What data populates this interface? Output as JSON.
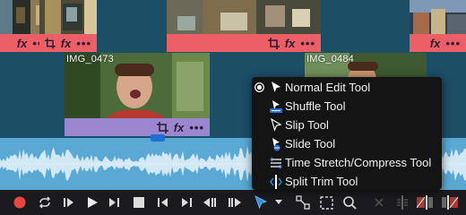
{
  "clips": {
    "top_left": {
      "name": ""
    },
    "top_mid": {
      "name": ""
    },
    "top_right": {
      "name": ""
    },
    "mid_left": {
      "name": "IMG_0473"
    },
    "mid_right": {
      "name": "IMG_0484"
    }
  },
  "clip_bar": {
    "fx_label": "fx",
    "more_label": "•••"
  },
  "colors": {
    "background": "#1c4e66",
    "clip_bar_red": "#ec5f67",
    "clip_bar_purple": "#9a87cf",
    "waveform": "#5aa9d5",
    "accent_blue": "#2e8ff0",
    "record_red": "#e8473f",
    "menu_bg": "#141414"
  },
  "menu": {
    "items": [
      {
        "label": "Normal Edit Tool",
        "icon": "pointer-arrow-icon",
        "selected": true
      },
      {
        "label": "Shuffle Tool",
        "icon": "shuffle-tool-icon",
        "selected": false
      },
      {
        "label": "Slip Tool",
        "icon": "slip-tool-icon",
        "selected": false
      },
      {
        "label": "Slide Tool",
        "icon": "slide-tool-icon",
        "selected": false
      },
      {
        "label": "Time Stretch/Compress Tool",
        "icon": "time-stretch-icon",
        "selected": false
      },
      {
        "label": "Split Trim Tool",
        "icon": "split-trim-icon",
        "selected": false
      }
    ]
  },
  "transport": {
    "buttons": [
      "record-icon",
      "loop-icon",
      "go-to-start-icon",
      "play-icon",
      "go-to-end-icon",
      "stop-icon",
      "step-back-icon",
      "step-forward-icon",
      "previous-marker-icon",
      "next-marker-icon",
      "edit-tool-icon",
      "chevron-down-icon",
      "snap-icon",
      "marquee-select-icon",
      "zoom-icon",
      "blade-icon",
      "split-icon",
      "ripple-left-icon",
      "ripple-right-icon"
    ]
  }
}
